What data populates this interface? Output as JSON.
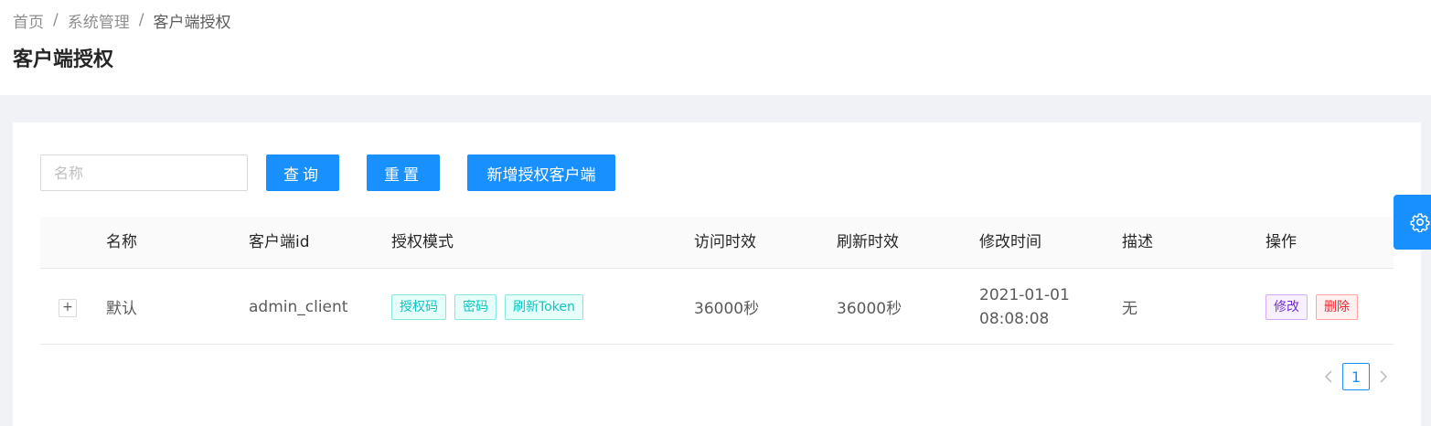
{
  "breadcrumb": {
    "items": [
      "首页",
      "系统管理",
      "客户端授权"
    ],
    "separator": "/"
  },
  "page": {
    "title": "客户端授权"
  },
  "search": {
    "placeholder": "名称",
    "value": ""
  },
  "buttons": {
    "query": "查询",
    "reset": "重置",
    "add": "新增授权客户端"
  },
  "table": {
    "columns": [
      "名称",
      "客户端id",
      "授权模式",
      "访问时效",
      "刷新时效",
      "修改时间",
      "描述",
      "操作"
    ],
    "rows": [
      {
        "expand": "+",
        "name": "默认",
        "client_id": "admin_client",
        "grant_modes": [
          "授权码",
          "密码",
          "刷新Token"
        ],
        "access_validity": "36000秒",
        "refresh_validity": "36000秒",
        "modified_date": "2021-01-01",
        "modified_time": "08:08:08",
        "description": "无",
        "actions": {
          "edit": "修改",
          "delete": "删除"
        }
      }
    ]
  },
  "pagination": {
    "current": "1",
    "prev_icon": "left-chevron-icon",
    "next_icon": "right-chevron-icon"
  },
  "settings": {
    "icon": "gear-icon"
  },
  "colors": {
    "primary": "#1890ff",
    "tag_cyan": "#13c2c2",
    "tag_purple": "#722ed1",
    "tag_red": "#f5222d"
  }
}
